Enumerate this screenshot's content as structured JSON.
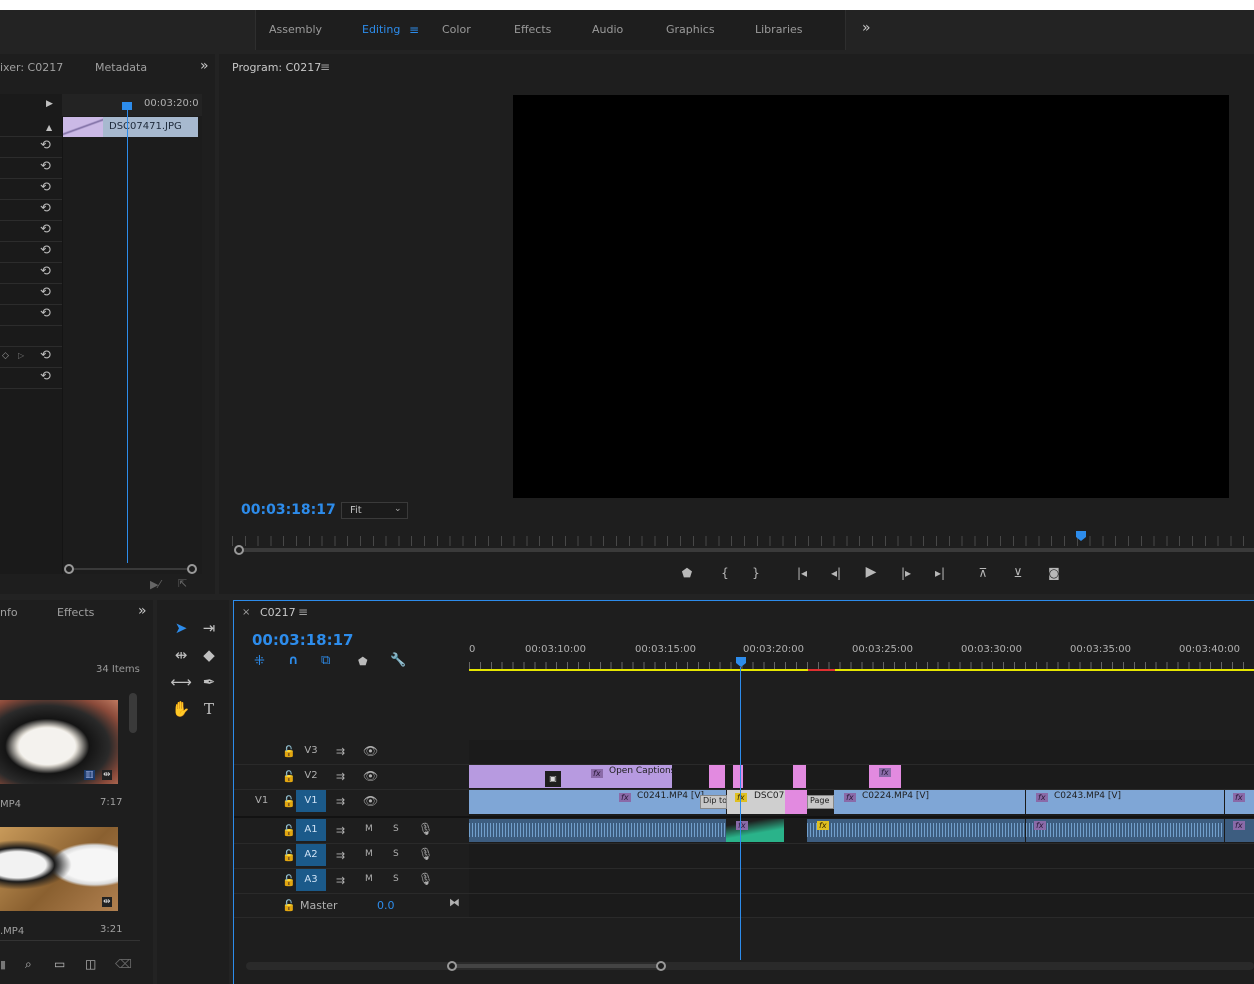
{
  "workspace": {
    "tabs": [
      {
        "label": "Assembly"
      },
      {
        "label": "Editing"
      },
      {
        "label": "Color"
      },
      {
        "label": "Effects"
      },
      {
        "label": "Audio"
      },
      {
        "label": "Graphics"
      },
      {
        "label": "Libraries"
      }
    ],
    "more": "»"
  },
  "effect_controls": {
    "tab1": "ixer: C0217",
    "tab2": "Metadata",
    "more": "»",
    "timecode": "00:03:20:0",
    "clip_name": "DSC07471.JPG"
  },
  "program": {
    "title": "Program: C0217",
    "menu": "≡",
    "timecode": "00:03:18:17",
    "fit": "Fit"
  },
  "project": {
    "tab1": "nfo",
    "tab2": "Effects",
    "more": "»",
    "items_count": "34 Items",
    "item1_name": "MP4",
    "item1_duration": "7:17",
    "item2_name": ".MP4",
    "item2_duration": "3:21"
  },
  "timeline": {
    "close": "×",
    "sequence": "C0217",
    "menu": "≡",
    "timecode": "00:03:18:17",
    "ruler": [
      "00:03:10:00",
      "00:03:15:00",
      "00:03:20:00",
      "00:03:25:00",
      "00:03:30:00",
      "00:03:35:00",
      "00:03:40:00"
    ],
    "ruler_partial": "0",
    "tracks": {
      "v3": "V3",
      "v2": "V2",
      "v1_src": "V1",
      "v1": "V1",
      "a1": "A1",
      "a2": "A2",
      "a3": "A3",
      "master": "Master",
      "master_value": "0.0",
      "m": "M",
      "s": "S"
    },
    "clips": {
      "open_captions": "Open Captions",
      "c0241": "C0241.MP4 [V]",
      "dip": "Dip to",
      "dsc": "DSC07",
      "page": "Page",
      "c0224": "C0224.MP4 [V]",
      "c0243": "C0243.MP4 [V]",
      "fx": "fx"
    }
  },
  "colors": {
    "accent": "#2d8ceb",
    "video_clip": "#7fa6d6",
    "caption_clip": "#b79ae0",
    "transition_clip": "#e28ae0",
    "audio_clip": "#6f9fcf",
    "audio_green": "#2ab38a",
    "ruler_yellow": "#e6e600"
  }
}
